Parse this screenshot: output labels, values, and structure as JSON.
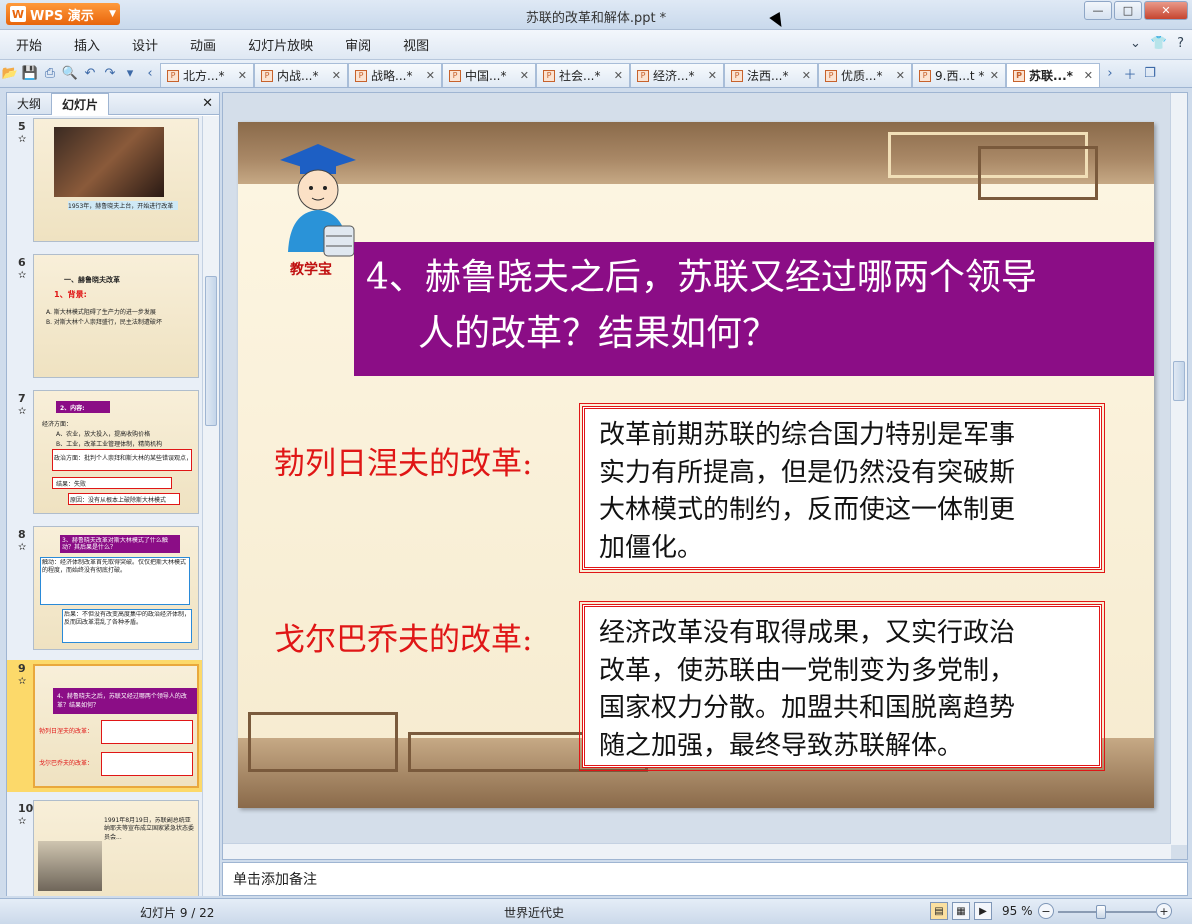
{
  "app": {
    "name": "WPS 演示",
    "window_title": "苏联的改革和解体.ppt *"
  },
  "menu": [
    "开始",
    "插入",
    "设计",
    "动画",
    "幻灯片放映",
    "审阅",
    "视图"
  ],
  "doc_tabs": [
    {
      "label": "北方...*",
      "active": false
    },
    {
      "label": "内战...*",
      "active": false
    },
    {
      "label": "战略...*",
      "active": false
    },
    {
      "label": "中国...*",
      "active": false
    },
    {
      "label": "社会...*",
      "active": false
    },
    {
      "label": "经济...*",
      "active": false
    },
    {
      "label": "法西...*",
      "active": false
    },
    {
      "label": "优质...*",
      "active": false
    },
    {
      "label": "9.西...t *",
      "active": false
    },
    {
      "label": "苏联...*",
      "active": true
    }
  ],
  "side_panel": {
    "tabs": [
      "大纲",
      "幻灯片"
    ],
    "active_tab": "幻灯片",
    "thumbnails": [
      {
        "num": "5",
        "caption": "1953年，赫鲁晓夫上台，开始进行改革"
      },
      {
        "num": "6",
        "heading": "一、赫鲁晓夫改革",
        "sub": "1、背景:",
        "line1": "A. 斯大林模式阻碍了生产力的进一步发展",
        "line2": "B. 对斯大林个人崇拜盛行，民主法制遭破坏"
      },
      {
        "num": "7",
        "heading": "2、内容:",
        "line1": "经济方面：",
        "line2": "A、农业，放大投入，提高收购价格",
        "line3": "B、工业，改革工业管理体制，精简机构",
        "line4": "政治方面：批判个人崇拜和斯大林的某些错误观点，平反冤假错案。",
        "line5": "结果：失败",
        "line6": "原因：没有从根本上破除斯大林模式"
      },
      {
        "num": "8",
        "heading": "3、赫鲁晓夫改革对斯大林模式了什么触动？其后果是什么？",
        "line1": "触动：经济体制改革首先取得突破。仅仅把斯大林模式的程度，而始终没有彻底打破。",
        "line2": "后果：不但没有改变高度集中的政治经济体制，反而因改革混乱了各种矛盾。"
      },
      {
        "num": "9",
        "heading": "4、赫鲁晓夫之后，苏联又经过哪两个领导人的改革？结果如何？",
        "left1": "勃列日涅夫的改革：",
        "left2": "戈尔巴乔夫的改革："
      },
      {
        "num": "10",
        "caption": "1991年8月19日，苏联副总统亚纳耶夫等宣布成立国家紧急状态委员会..."
      }
    ]
  },
  "slide": {
    "mascot_label": "教学宝",
    "title_line1": "4、赫鲁晓夫之后，苏联又经过哪两个领导",
    "title_line2": "人的改革？结果如何？",
    "label1": "勃列日涅夫的改革:",
    "box1_lines": [
      "改革前期苏联的综合国力特别是军事",
      "实力有所提高，但是仍然没有突破斯",
      "大林模式的制约，反而使这一体制更",
      "加僵化。"
    ],
    "label2": "戈尔巴乔夫的改革:",
    "box2_lines": [
      "经济改革没有取得成果，又实行政治",
      "改革，使苏联由一党制变为多党制，",
      "国家权力分散。加盟共和国脱离趋势",
      "随之加强，最终导致苏联解体。"
    ]
  },
  "notes_placeholder": "单击添加备注",
  "status": {
    "slide_indicator": "幻灯片 9 / 22",
    "theme": "世界近代史",
    "zoom": "95 %"
  },
  "colors": {
    "title_bg": "#8b0d86",
    "label_red": "#e01616",
    "accent_orange": "#e8650c"
  }
}
